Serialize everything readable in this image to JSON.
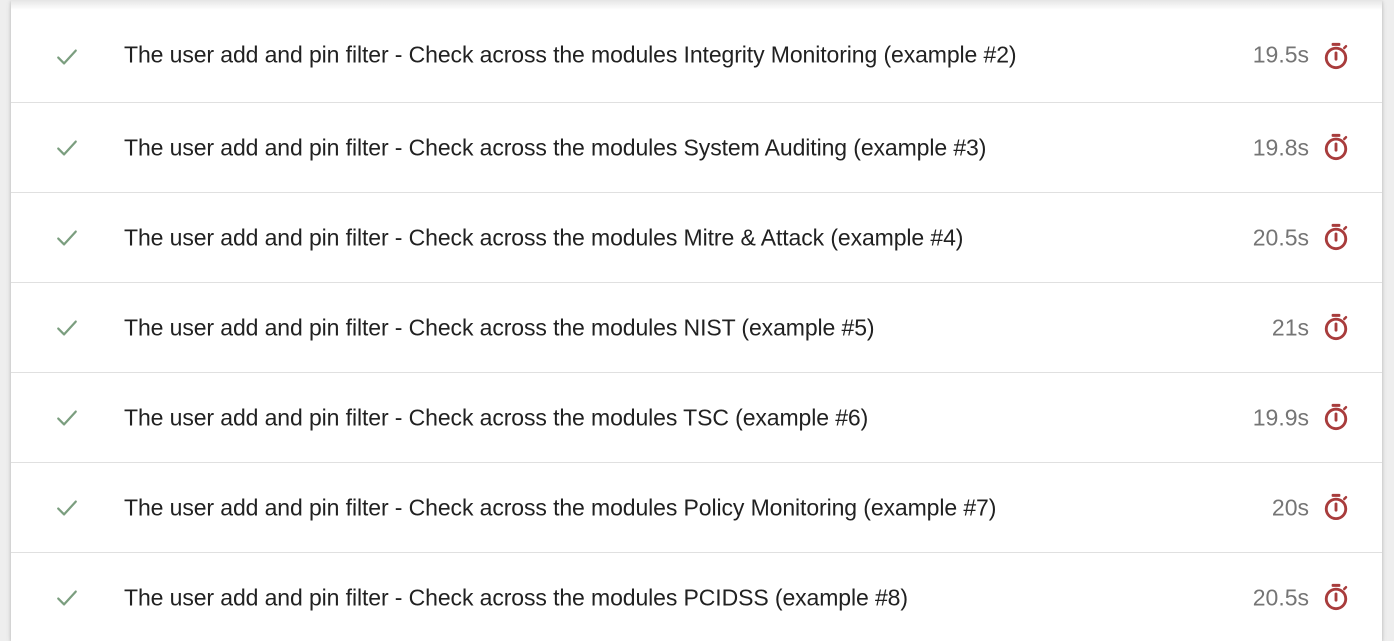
{
  "colors": {
    "pass": "#7b9e7f",
    "timer": "#a83c3c"
  },
  "icons": {
    "status": "check-icon",
    "duration": "timer-icon"
  },
  "tests": [
    {
      "title": "The user add and pin filter - Check across the modules Integrity Monitoring (example #2)",
      "duration": "19.5s",
      "status": "passed"
    },
    {
      "title": "The user add and pin filter - Check across the modules System Auditing (example #3)",
      "duration": "19.8s",
      "status": "passed"
    },
    {
      "title": "The user add and pin filter - Check across the modules Mitre & Attack (example #4)",
      "duration": "20.5s",
      "status": "passed"
    },
    {
      "title": "The user add and pin filter - Check across the modules NIST (example #5)",
      "duration": "21s",
      "status": "passed"
    },
    {
      "title": "The user add and pin filter - Check across the modules TSC (example #6)",
      "duration": "19.9s",
      "status": "passed"
    },
    {
      "title": "The user add and pin filter - Check across the modules Policy Monitoring (example #7)",
      "duration": "20s",
      "status": "passed"
    },
    {
      "title": "The user add and pin filter - Check across the modules PCIDSS (example #8)",
      "duration": "20.5s",
      "status": "passed"
    }
  ]
}
